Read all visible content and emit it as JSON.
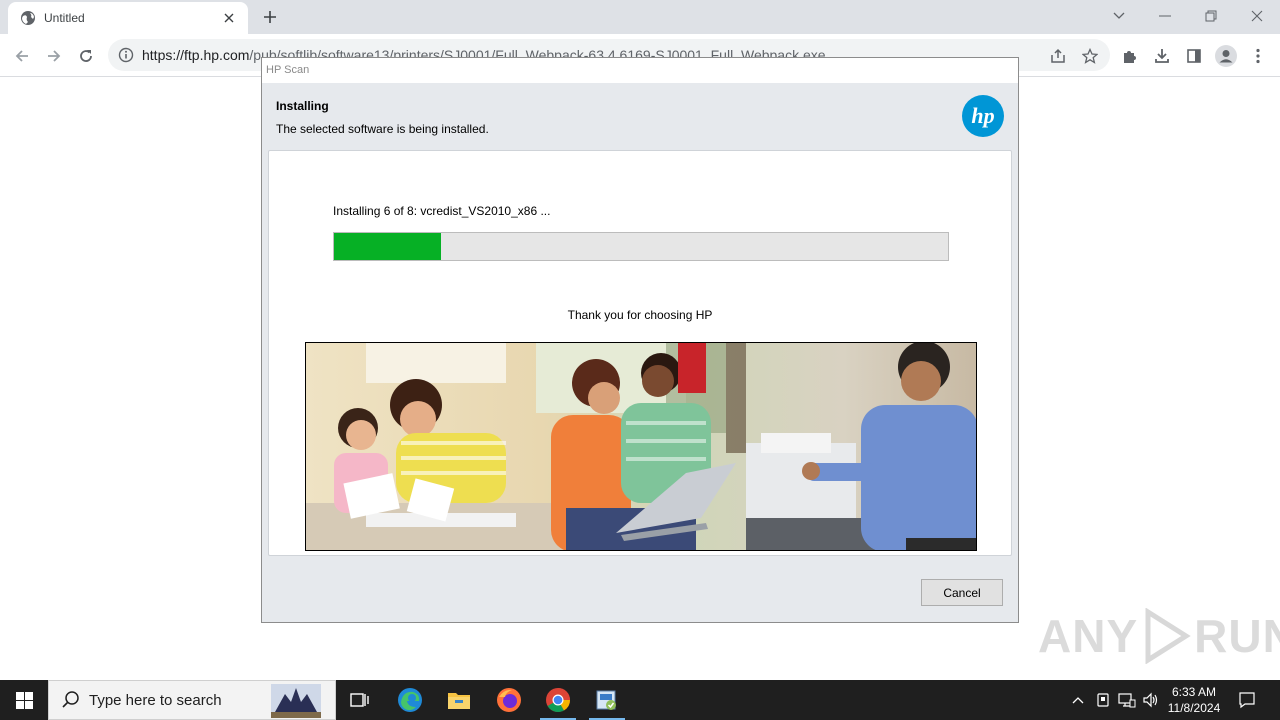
{
  "browser": {
    "tab_title": "Untitled",
    "url_host": "https://ftp.hp.com",
    "url_path": "/pub/softlib/software13/printers/SJ0001/Full_Webpack-63.4.6169-SJ0001_Full_Webpack.exe"
  },
  "dialog": {
    "window_title": "HP Scan",
    "heading": "Installing",
    "subheading": "The selected software is being installed.",
    "status_text": "Installing 6 of 8: vcredist_VS2010_x86 ...",
    "progress_percent": 17.5,
    "thanks_text": "Thank you for choosing HP",
    "logo_text": "hp",
    "cancel_label": "Cancel",
    "accent_color": "#06b025",
    "logo_color": "#0096d6"
  },
  "watermark": {
    "left_text": "ANY",
    "right_text": "RUN"
  },
  "taskbar": {
    "search_placeholder": "Type here to search",
    "time": "6:33 AM",
    "date": "11/8/2024",
    "apps": [
      "windows-start-icon",
      "task-view-icon",
      "edge-icon",
      "file-explorer-icon",
      "firefox-icon",
      "chrome-icon",
      "installer-icon"
    ]
  }
}
